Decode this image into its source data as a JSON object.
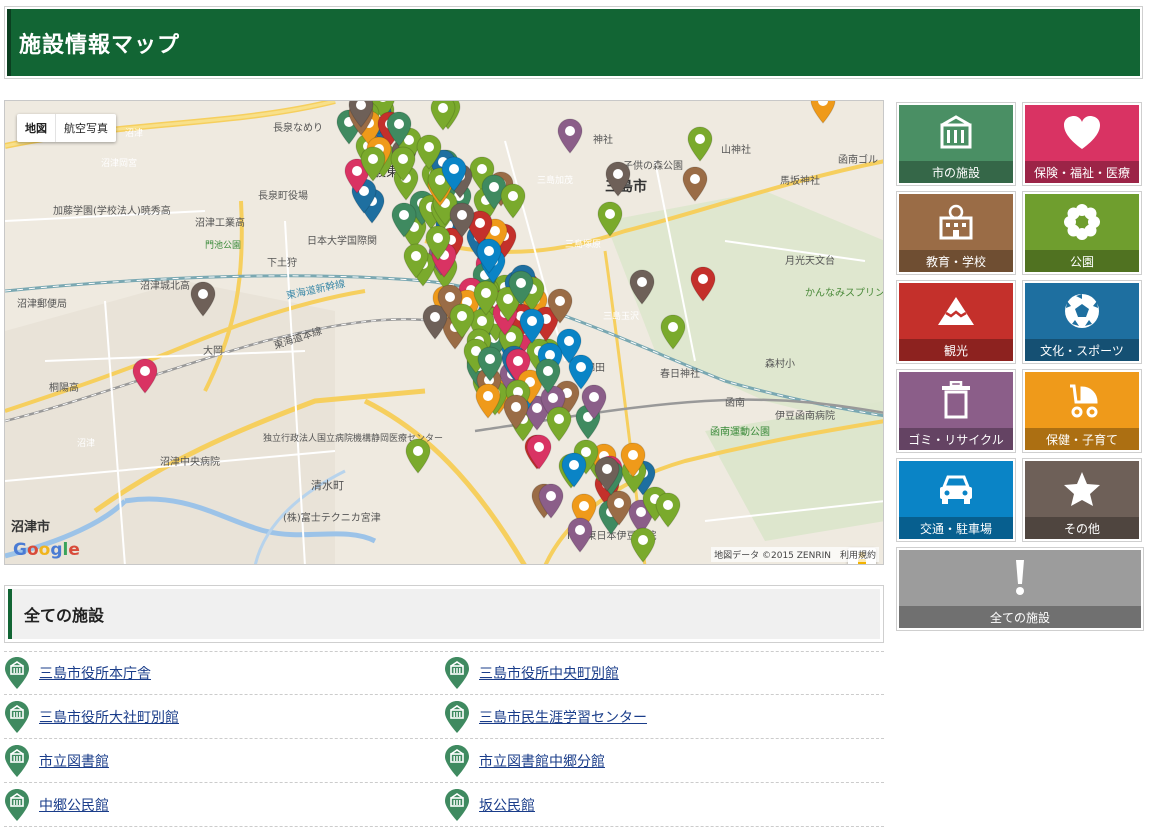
{
  "page": {
    "title": "施設情報マップ"
  },
  "map": {
    "map_type_options": [
      "地図",
      "航空写真"
    ],
    "active_map_type": "地図",
    "credit": "地図データ ©2015 ZENRIN　利用規約",
    "google_logo": "Google",
    "zoom_in": "+",
    "zoom_out": "−",
    "place_labels": [
      "長泉町役場",
      "長泉なめり",
      "沼津",
      "沼津岡宮",
      "加藤学園(学校法人)暁秀高",
      "沼津工業高",
      "門池公園",
      "日本大学国際関",
      "下土狩",
      "沼津城北高",
      "沼津郵便局",
      "東海道新幹線",
      "東海道本線",
      "大岡",
      "桐陽高",
      "沼津",
      "独立行政法人国立病院機構静岡医療センター",
      "沼津中央病院",
      "清水町",
      "(株)富士テクニカ宮津",
      "沼津市",
      "三島市",
      "山神社",
      "子供の森公園",
      "馬坂神社",
      "三島加茂",
      "三島塚原",
      "月光天文台",
      "かんなみスプリングスカントリー",
      "三島玉沢",
      "春日神社",
      "錦田",
      "森村小",
      "函南",
      "伊豆函南病院",
      "函南運動公園",
      "NTT東日本伊豆病院",
      "駿東",
      "函南ゴル",
      "神社"
    ],
    "marker_types": [
      "city-facility",
      "welfare",
      "education",
      "park",
      "tourism",
      "culture-sports",
      "recycle",
      "childcare",
      "transport",
      "other"
    ]
  },
  "categories": [
    {
      "id": "city",
      "label": "市の施設",
      "color": "#4a8f64",
      "icon": "building-icon"
    },
    {
      "id": "welfare",
      "label": "保険・福祉・医療",
      "color": "#d93363",
      "icon": "heart-icon"
    },
    {
      "id": "education",
      "label": "教育・学校",
      "color": "#9a6c46",
      "icon": "school-icon"
    },
    {
      "id": "park",
      "label": "公園",
      "color": "#6f9e2e",
      "icon": "flower-icon"
    },
    {
      "id": "tourism",
      "label": "観光",
      "color": "#c4302b",
      "icon": "mountain-icon"
    },
    {
      "id": "culture",
      "label": "文化・スポーツ",
      "color": "#1e6fa0",
      "icon": "ball-icon"
    },
    {
      "id": "recycle",
      "label": "ゴミ・リサイクル",
      "color": "#8b5e89",
      "icon": "trash-icon"
    },
    {
      "id": "childcare",
      "label": "保健・子育て",
      "color": "#ef9a1a",
      "icon": "stroller-icon"
    },
    {
      "id": "transport",
      "label": "交通・駐車場",
      "color": "#0a84c6",
      "icon": "car-icon"
    },
    {
      "id": "other",
      "label": "その他",
      "color": "#6e6058",
      "icon": "star-icon"
    },
    {
      "id": "all",
      "label": "全ての施設",
      "color": "#9c9c9c",
      "icon": "exclamation-icon"
    }
  ],
  "facilities": {
    "heading": "全ての施設",
    "rows": [
      [
        "三島市役所本庁舎",
        "三島市役所中央町別館"
      ],
      [
        "三島市役所大社町別館",
        "三島市民生涯学習センター"
      ],
      [
        "市立図書館",
        "市立図書館中郷分館"
      ],
      [
        "中郷公民館",
        "坂公民館"
      ]
    ]
  }
}
